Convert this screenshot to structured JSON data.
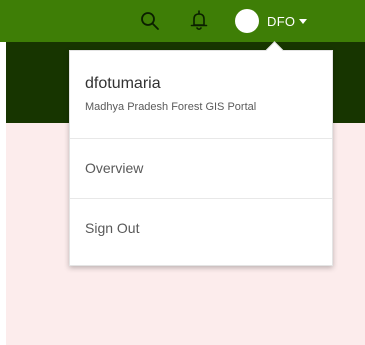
{
  "header": {
    "user_label": "DFO",
    "icons": [
      "search-icon",
      "bell-icon",
      "avatar",
      "caret-down-icon"
    ]
  },
  "user_menu": {
    "username": "dfotumaria",
    "org_name": "Madhya Pradesh Forest GIS Portal",
    "items": [
      {
        "label": "Overview"
      },
      {
        "label": "Sign Out"
      }
    ]
  },
  "colors": {
    "header_green": "#3e7e06",
    "sub_header_dark_green": "#173500",
    "content_pink": "#fcecec"
  }
}
